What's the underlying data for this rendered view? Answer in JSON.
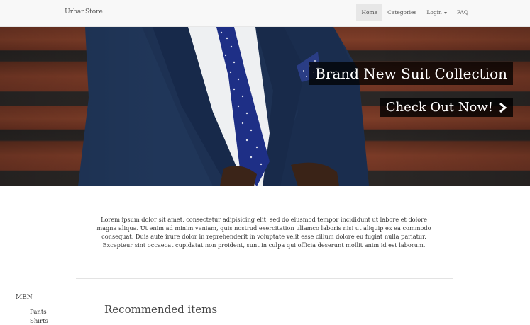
{
  "navbar": {
    "brand": "UrbanStore",
    "items": [
      {
        "label": "Home",
        "active": true
      },
      {
        "label": "Categories"
      },
      {
        "label": "Login",
        "dropdown": true
      },
      {
        "label": "FAQ"
      }
    ]
  },
  "hero": {
    "caption": "Brand New Suit Collection",
    "cta_label": "Check Out Now!",
    "cta_icon": "chevron-right-icon"
  },
  "intro": {
    "text": "Lorem ipsum dolor sit amet, consectetur adipisicing elit, sed do eiusmod tempor incididunt ut labore et dolore magna aliqua. Ut enim ad minim veniam, quis nostrud exercitation ullamco laboris nisi ut aliquip ex ea commodo consequat. Duis aute irure dolor in reprehenderit in voluptate velit esse cillum dolore eu fugiat nulla pariatur. Excepteur sint occaecat cupidatat non proident, sunt in culpa qui officia deserunt mollit anim id est laborum."
  },
  "sidebar": {
    "heading": "MEN",
    "items": [
      {
        "label": "Pants"
      },
      {
        "label": "Shirts"
      }
    ]
  },
  "main": {
    "section_title": "Recommended items"
  }
}
